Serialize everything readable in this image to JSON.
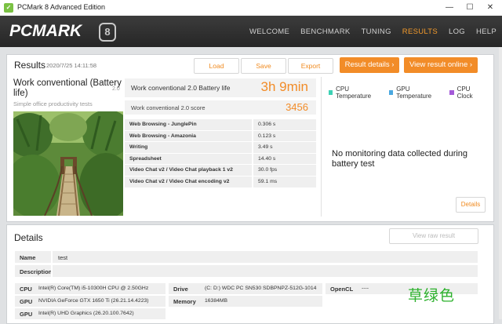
{
  "window": {
    "title": "PCMark 8 Advanced Edition",
    "minimize": "—",
    "maximize": "☐",
    "close": "✕"
  },
  "header": {
    "logo_text": "PCMARK",
    "logo_badge": "8",
    "nav": [
      "WELCOME",
      "BENCHMARK",
      "TUNING",
      "RESULTS",
      "LOG",
      "HELP"
    ],
    "active_nav": "RESULTS"
  },
  "results": {
    "title": "Results",
    "date": "2020/7/25 14:11:58",
    "buttons": {
      "load": "Load",
      "save": "Save",
      "export": "Export",
      "result_details": "Result details",
      "view_online": "View result online"
    },
    "benchmark": {
      "name": "Work conventional (Battery life)",
      "version": "2.0",
      "description": "Simple office productivity tests"
    },
    "battery_life_label": "Work conventional 2.0 Battery life",
    "battery_life_value": "3h 9min",
    "score_label": "Work conventional 2.0 score",
    "score_value": "3456",
    "subtests": [
      {
        "name": "Web Browsing - JunglePin",
        "value": "0.306 s"
      },
      {
        "name": "Web Browsing - Amazonia",
        "value": "0.123 s"
      },
      {
        "name": "Writing",
        "value": "3.49 s"
      },
      {
        "name": "Spreadsheet",
        "value": "14.40 s"
      },
      {
        "name": "Video Chat v2 / Video Chat playback 1 v2",
        "value": "30.0 fps"
      },
      {
        "name": "Video Chat v2 / Video Chat encoding v2",
        "value": "59.1 ms"
      }
    ],
    "legend": [
      {
        "label": "CPU Temperature",
        "color": "#3dd1b5"
      },
      {
        "label": "GPU Temperature",
        "color": "#4aa8e0"
      },
      {
        "label": "CPU Clock",
        "color": "#a45ad8"
      }
    ],
    "no_data": "No monitoring data collected during battery test",
    "details_button": "Details"
  },
  "details": {
    "title": "Details",
    "view_raw": "View raw result",
    "name_label": "Name",
    "name_value": "test",
    "description_label": "Description",
    "description_value": "",
    "hardware": {
      "cpu_label": "CPU",
      "cpu_value": "Intel(R) Core(TM) i5-10300H CPU @ 2.50GHz",
      "gpu1_label": "GPU",
      "gpu1_value": "NVIDIA GeForce GTX 1650 Ti (26.21.14.4223)",
      "gpu2_label": "GPU",
      "gpu2_value": "Intel(R) UHD Graphics (26.20.100.7642)",
      "drive_label": "Drive",
      "drive_value": "(C: D:) WDC PC SN530 SDBPNPZ-512G-1014",
      "memory_label": "Memory",
      "memory_value": "16384MB",
      "opencl_label": "OpenCL",
      "opencl_value": "----"
    }
  },
  "watermark": "草绿色"
}
